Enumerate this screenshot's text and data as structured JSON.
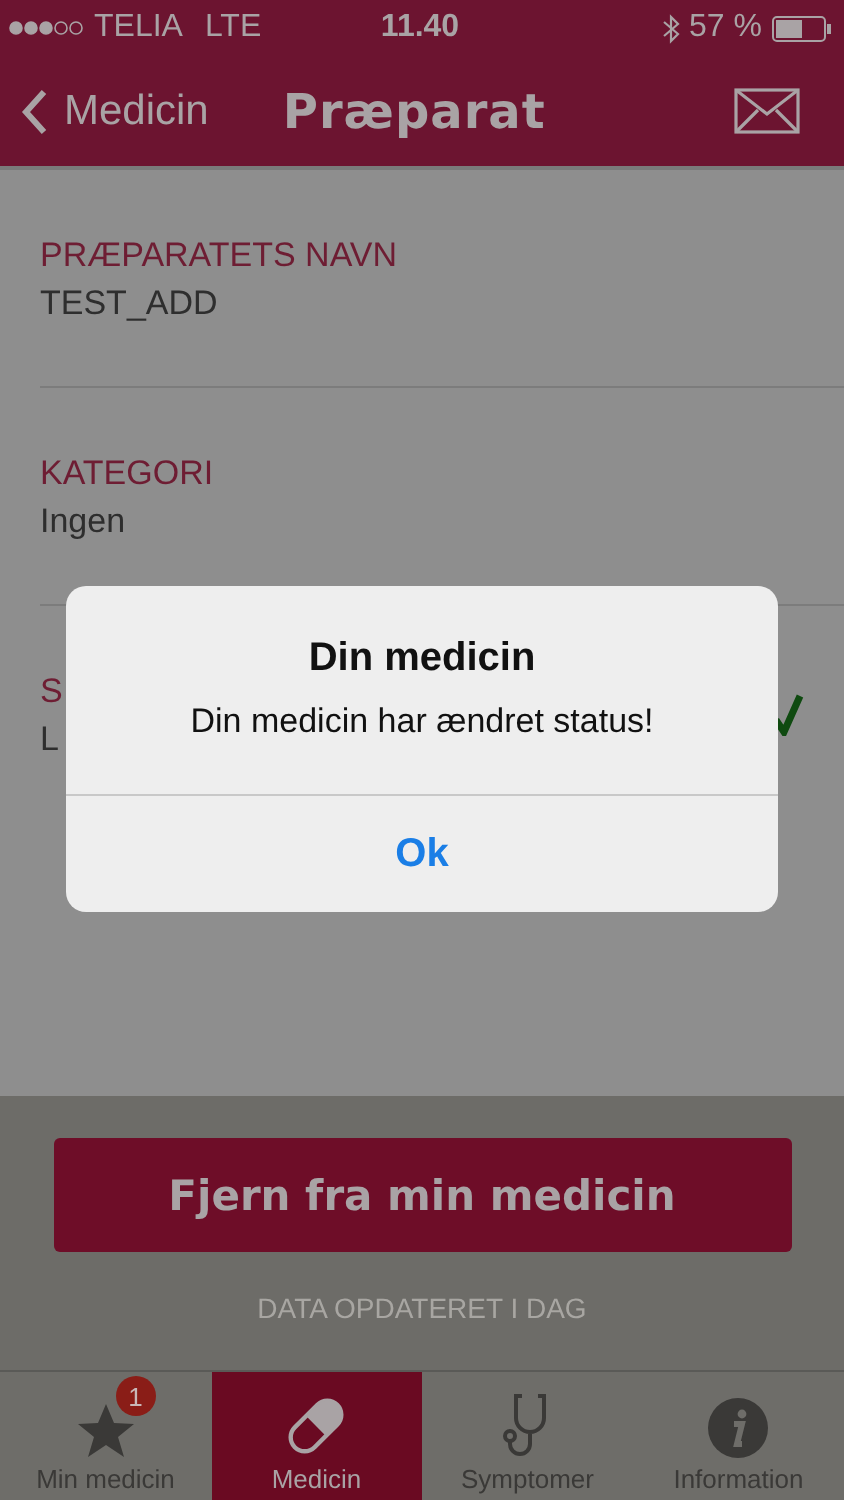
{
  "status_bar": {
    "carrier": "TELIA",
    "network": "LTE",
    "time": "11.40",
    "battery": "57 %"
  },
  "nav_bar": {
    "back": "Medicin",
    "title": "Præparat"
  },
  "fields": [
    {
      "label": "PRÆPARATETS NAVN",
      "value": "TEST_ADD",
      "checked": false
    },
    {
      "label": "KATEGORI",
      "value": "Ingen",
      "checked": false
    },
    {
      "label": "S",
      "value": "L",
      "checked": true
    }
  ],
  "action_button": "Fjern fra min medicin",
  "updated_note": "DATA OPDATERET I DAG",
  "tabs": [
    {
      "label": "Min medicin",
      "kind": "star",
      "badge": "1",
      "selected": false
    },
    {
      "label": "Medicin",
      "kind": "pill",
      "selected": true
    },
    {
      "label": "Symptomer",
      "kind": "stethoscope",
      "selected": false
    },
    {
      "label": "Information",
      "kind": "info",
      "selected": false
    }
  ],
  "alert": {
    "title": "Din medicin",
    "message": "Din medicin har ændret status!",
    "button": "Ok"
  }
}
